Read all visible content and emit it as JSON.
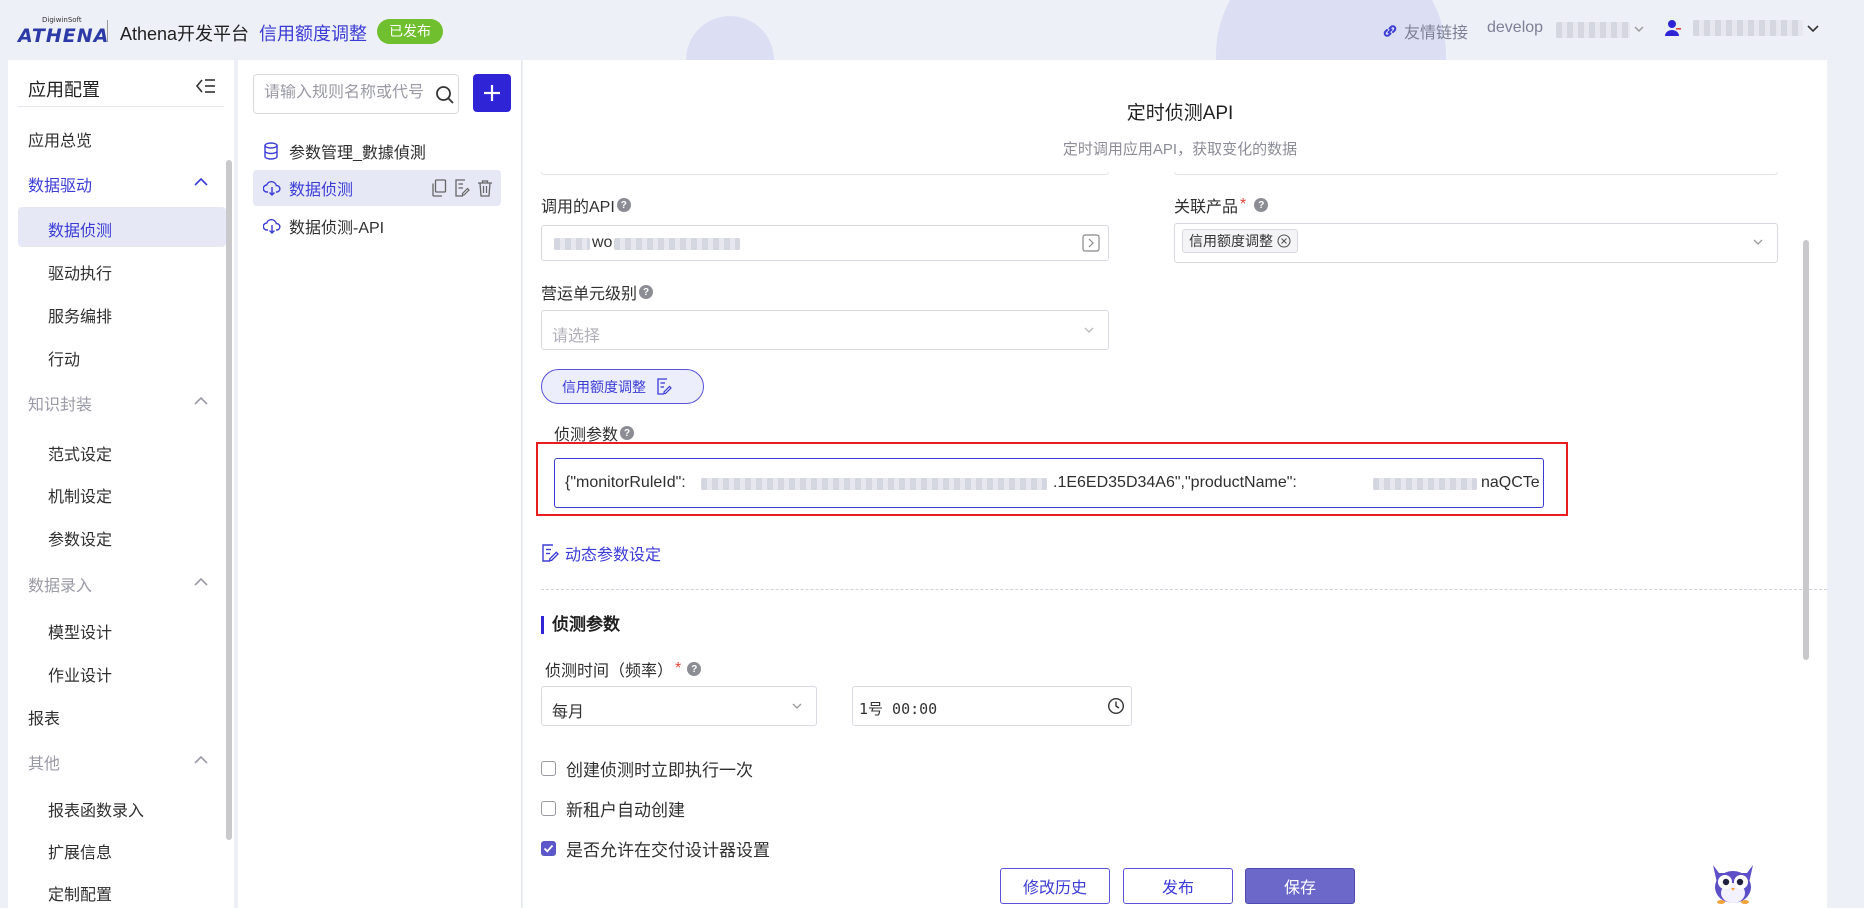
{
  "header": {
    "logo_small": "DigiwinSoft",
    "logo_text": "ATHENA",
    "platform_title": "Athena开发平台",
    "app_name": "信用额度调整",
    "status_badge": "已发布",
    "friend_link": "友情链接",
    "environment": "develop"
  },
  "sidebar": {
    "title": "应用配置",
    "items": [
      {
        "label": "应用总览",
        "level": "group",
        "state": "normal"
      },
      {
        "label": "数据驱动",
        "level": "group",
        "state": "active-group",
        "expanded": true
      },
      {
        "label": "数据侦测",
        "level": "sub",
        "state": "selected"
      },
      {
        "label": "驱动执行",
        "level": "sub"
      },
      {
        "label": "服务编排",
        "level": "sub"
      },
      {
        "label": "行动",
        "level": "sub"
      },
      {
        "label": "知识封装",
        "level": "group",
        "state": "muted",
        "expanded": true
      },
      {
        "label": "范式设定",
        "level": "sub"
      },
      {
        "label": "机制设定",
        "level": "sub"
      },
      {
        "label": "参数设定",
        "level": "sub"
      },
      {
        "label": "数据录入",
        "level": "group",
        "state": "muted",
        "expanded": true
      },
      {
        "label": "模型设计",
        "level": "sub"
      },
      {
        "label": "作业设计",
        "level": "sub"
      },
      {
        "label": "报表",
        "level": "group",
        "state": "normal"
      },
      {
        "label": "其他",
        "level": "group",
        "state": "muted",
        "expanded": true
      },
      {
        "label": "报表函数录入",
        "level": "sub"
      },
      {
        "label": "扩展信息",
        "level": "sub"
      },
      {
        "label": "定制配置",
        "level": "sub"
      }
    ]
  },
  "rules_panel": {
    "search_placeholder": "请输入规则名称或代号",
    "rules": [
      {
        "label": "参数管理_數據偵測",
        "icon": "database-icon"
      },
      {
        "label": "数据侦测",
        "icon": "cloud-download-icon",
        "active": true
      },
      {
        "label": "数据侦测-API",
        "icon": "cloud-download-icon"
      }
    ]
  },
  "main": {
    "title": "定时侦测API",
    "subtitle": "定时调用应用API，获取变化的数据",
    "api_label": "调用的API",
    "api_value_visible": "wo",
    "related_product_label": "关联产品",
    "related_product_tag": "信用额度调整",
    "op_unit_label": "营运单元级别",
    "op_unit_placeholder": "请选择",
    "pill_button_label": "信用额度调整",
    "detect_params_label": "侦测参数",
    "detect_params_prefix": "{\"monitorRuleId\":",
    "detect_params_middle": ".1E6ED35D34A6\",\"productName\":",
    "detect_params_suffix": "naQCTe",
    "dynamic_param_link": "动态参数设定",
    "section_title": "侦测参数",
    "freq_label": "侦测时间（频率）",
    "freq_value": "每月",
    "time_value": "1号 00:00",
    "checkboxes": [
      {
        "label": "创建侦测时立即执行一次",
        "checked": false
      },
      {
        "label": "新租户自动创建",
        "checked": false
      },
      {
        "label": "是否允许在交付设计器设置",
        "checked": true
      }
    ],
    "buttons": {
      "history": "修改历史",
      "publish": "发布",
      "save": "保存"
    }
  },
  "colors": {
    "accent": "#3b3bd6",
    "primary_button": "#2f25d6",
    "published_badge": "#6fbf2e",
    "highlight_border": "#e81d1d"
  }
}
